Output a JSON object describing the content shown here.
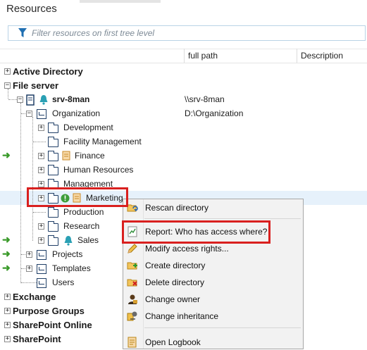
{
  "panel": {
    "title": "Resources",
    "filter_placeholder": "Filter resources on first tree level"
  },
  "columns": {
    "full_path": "full path",
    "description": "Description"
  },
  "tree": {
    "active_directory": "Active Directory",
    "file_server": "File server",
    "server": {
      "label": "srv-8man",
      "path": "\\\\srv-8man"
    },
    "organization": {
      "label": "Organization",
      "path": "D:\\Organization"
    },
    "folders": [
      "Development",
      "Facility Management",
      "Finance",
      "Human Resources",
      "Management",
      "Marketing",
      "Production",
      "Research",
      "Sales"
    ],
    "projects": "Projects",
    "templates": "Templates",
    "users": "Users",
    "exchange": "Exchange",
    "purpose_groups": "Purpose Groups",
    "sharepoint_online": "SharePoint Online",
    "sharepoint": "SharePoint"
  },
  "context_menu": {
    "items": [
      "Rescan directory",
      "Report: Who has access where?",
      "Modify access rights...",
      "Create directory",
      "Delete directory",
      "Change owner",
      "Change inheritance",
      "Open Logbook"
    ]
  },
  "colors": {
    "highlight_red": "#d9201f",
    "arrow_green": "#3a9a2a",
    "filter_blue": "#1f6fb2"
  }
}
